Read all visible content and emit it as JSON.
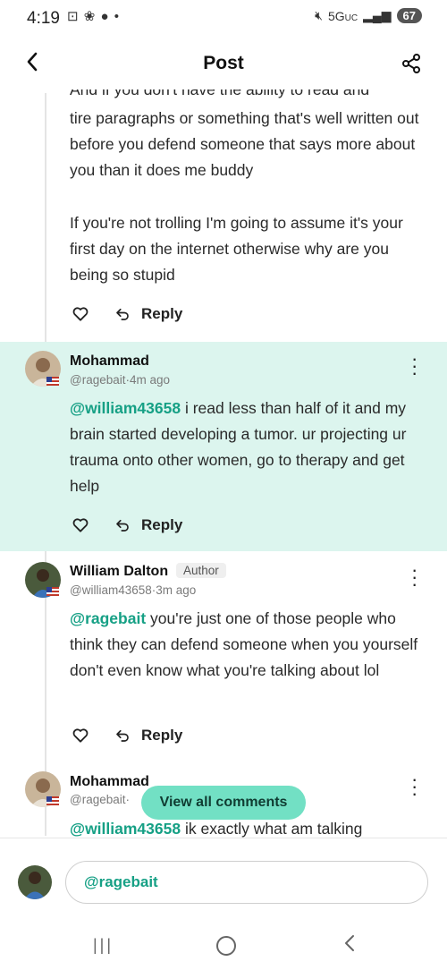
{
  "status_bar": {
    "time": "4:19",
    "left_icons": "⊡ ❀ ●",
    "dot": "•",
    "network": "5G",
    "network_suffix": "UC",
    "battery": "67"
  },
  "header": {
    "title": "Post"
  },
  "previous_comment": {
    "clipped_line": "And if you don't have the ability to read and",
    "paragraph1": "tire paragraphs or something that's well written out before you defend someone that says more about you than it does me buddy",
    "paragraph2": "If you're not trolling I'm going to assume it's your first day on the internet otherwise why are you being so stupid",
    "reply_label": "Reply"
  },
  "comments": [
    {
      "name": "Mohammad",
      "handle": "@ragebait",
      "separator": "·",
      "time": "4m ago",
      "mention": "@william43658",
      "text": " i read less than half of it and my brain started developing a tumor. ur projecting ur trauma onto other women, go to therapy and get help",
      "reply_label": "Reply"
    },
    {
      "name": "William Dalton",
      "badge": "Author",
      "handle": "@william43658",
      "separator": "·",
      "time": "3m ago",
      "mention": "@ragebait",
      "text": " you're just one of those people who think they can defend someone when you yourself don't even know what you're talking about lol",
      "reply_label": "Reply"
    },
    {
      "name": "Mohammad",
      "handle": "@ragebait",
      "separator": "·",
      "mention": "@william43658",
      "text": " ik exactly what am talking"
    }
  ],
  "view_all_label": "View all comments",
  "composer": {
    "value": "@ragebait"
  },
  "colors": {
    "highlight": "#dcf5ee",
    "accent": "#16a085",
    "pill": "#72e0c4"
  }
}
